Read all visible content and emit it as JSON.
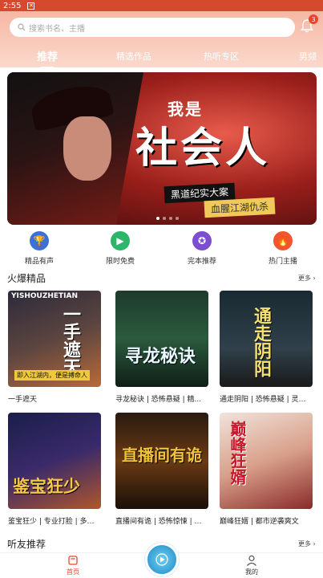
{
  "status": {
    "time": "2:55"
  },
  "search": {
    "placeholder": "搜索书名、主播"
  },
  "notifications": {
    "count": "3"
  },
  "tabs": [
    {
      "label": "推荐"
    },
    {
      "label": "精选作品"
    },
    {
      "label": "热听专区"
    },
    {
      "label": "男频"
    }
  ],
  "banner": {
    "title_top": "我是",
    "title_main": "社会人",
    "sub1": "黑道纪实大案",
    "sub2": "血腥江湖仇杀"
  },
  "quick": [
    {
      "label": "精品有声",
      "icon": "trophy-icon",
      "color": "#3d6fd6"
    },
    {
      "label": "限时免费",
      "icon": "play-circle-icon",
      "color": "#2db56a"
    },
    {
      "label": "完本推荐",
      "icon": "medal-icon",
      "color": "#7b4fd0"
    },
    {
      "label": "热门主播",
      "icon": "flame-icon",
      "color": "#f0552e"
    }
  ],
  "hot": {
    "title": "火爆精品",
    "more": "更多",
    "items": [
      {
        "caption": "一手遮天",
        "cover_text": "一手遮天",
        "cover_top": "YISHOUZHETIAN",
        "cover_band": "即入江湖内，便是搏命人"
      },
      {
        "caption": "寻龙秘诀 | 恐怖悬疑 | 精...",
        "cover_text": "寻龙秘诀"
      },
      {
        "caption": "通走阴阳 | 恐怖悬疑 | 灵异惊...",
        "cover_text": "通走阴阳"
      },
      {
        "caption": "鉴宝狂少 | 专业打脸 | 多人...",
        "cover_text": "鉴宝狂少"
      },
      {
        "caption": "直播间有诡 | 恐怖惊悚 | 高...",
        "cover_text": "直播间有诡"
      },
      {
        "caption": "巅峰狂婿 | 都市逆袭爽文",
        "cover_text": "巅峰狂婿"
      }
    ]
  },
  "friends": {
    "title": "听友推荐",
    "more": "更多"
  },
  "bottom": {
    "home": "首页",
    "mine": "我的"
  },
  "colors": {
    "accent": "#e8452c",
    "header": "#f6b7a3"
  }
}
